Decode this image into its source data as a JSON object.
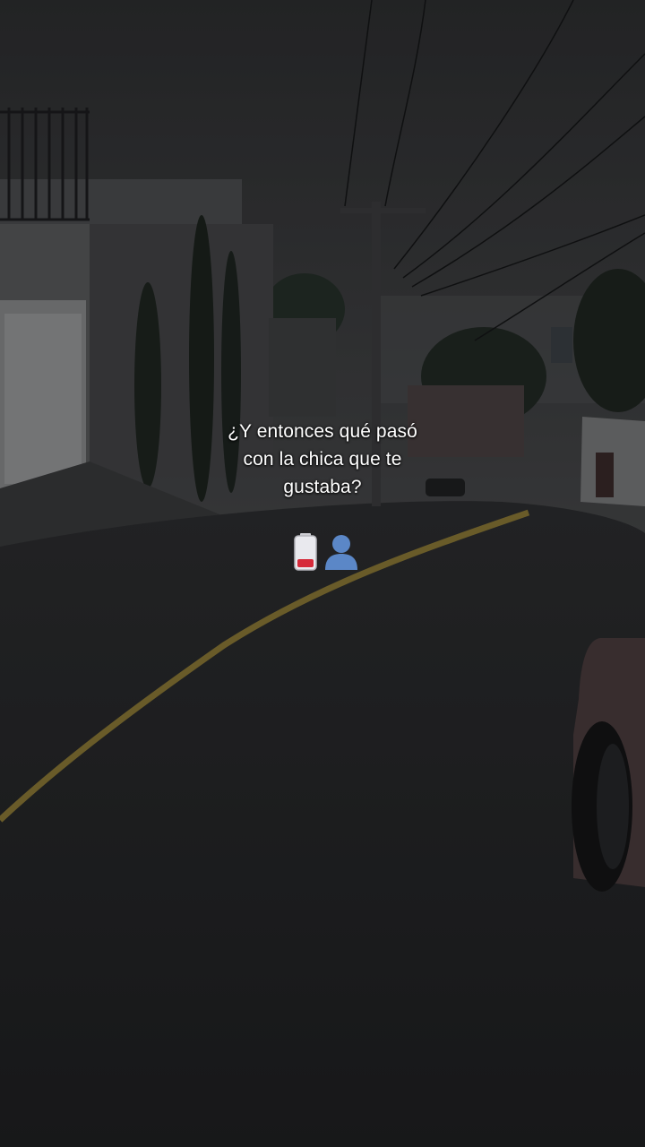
{
  "caption": {
    "line1": "¿Y entonces qué pasó",
    "line2": "con la chica que te",
    "line3": "gustaba?"
  },
  "emojis": [
    "low-battery-icon",
    "person-silhouette-icon"
  ],
  "colors": {
    "sky": "#3a3b3d",
    "road": "#2a2a2c",
    "road_line": "#b89a35",
    "text": "#ffffff",
    "battery_red": "#d62a3a",
    "person_blue": "#5b87c7"
  }
}
